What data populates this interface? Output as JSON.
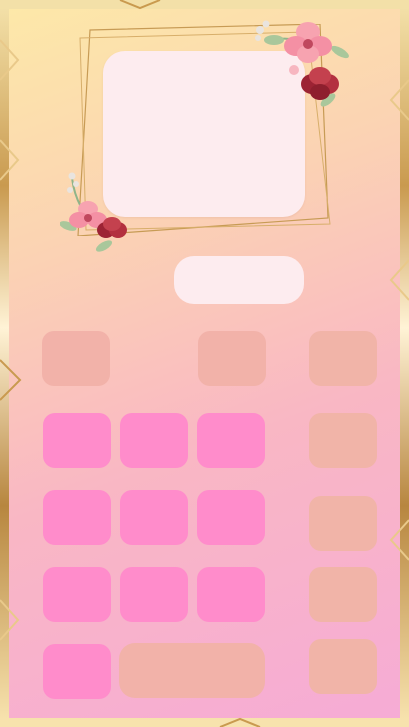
{
  "app": {
    "title": ""
  },
  "display": {
    "value": ""
  },
  "memory": {
    "value": ""
  },
  "keys": {
    "r1": [
      "",
      "",
      ""
    ],
    "r2": [
      "",
      "",
      "",
      ""
    ],
    "r3": [
      "",
      "",
      "",
      ""
    ],
    "r4": [
      "",
      "",
      "",
      ""
    ],
    "r5": [
      "",
      "",
      ""
    ]
  },
  "colors": {
    "gold": "#c99a4f",
    "screen": "#fdecef",
    "key_peach": "#f2b2a9",
    "key_pink": "#ff8ccb",
    "flower_petal": "#f48fa4",
    "flower_dark": "#b3303f",
    "leaf": "#8fb58a"
  },
  "icons": [
    "floral-corner-top-right",
    "floral-corner-bottom-left",
    "gold-geometric-frame"
  ]
}
